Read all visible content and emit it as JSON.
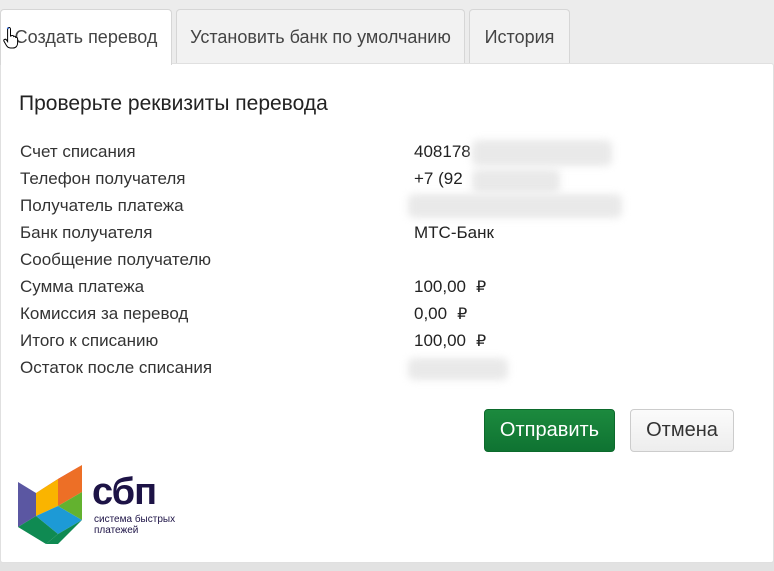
{
  "tabs": [
    {
      "label": "Создать перевод",
      "active": true
    },
    {
      "label": "Установить банк по умолчанию",
      "active": false
    },
    {
      "label": "История",
      "active": false
    }
  ],
  "confirm": {
    "title": "Проверьте реквизиты перевода",
    "rows": [
      {
        "label": "Счет списания",
        "value": "408178"
      },
      {
        "label": "Телефон получателя",
        "value": "+7 (92"
      },
      {
        "label": "Получатель платежа",
        "value": ""
      },
      {
        "label": "Банк получателя",
        "value": "МТС-Банк"
      },
      {
        "label": "Сообщение получателю",
        "value": ""
      },
      {
        "label": "Сумма платежа",
        "value": "100,00"
      },
      {
        "label": "Комиссия за перевод",
        "value": "0,00"
      },
      {
        "label": "Итого к списанию",
        "value": "100,00"
      },
      {
        "label": "Остаток после списания",
        "value": ""
      }
    ],
    "currency_symbol": "₽"
  },
  "actions": {
    "submit_label": "Отправить",
    "cancel_label": "Отмена"
  },
  "logo": {
    "name": "сбп",
    "tagline_line1": "система быстрых",
    "tagline_line2": "платежей"
  },
  "colors": {
    "submit_button": "#11783a",
    "logo_text": "#1d1346"
  }
}
